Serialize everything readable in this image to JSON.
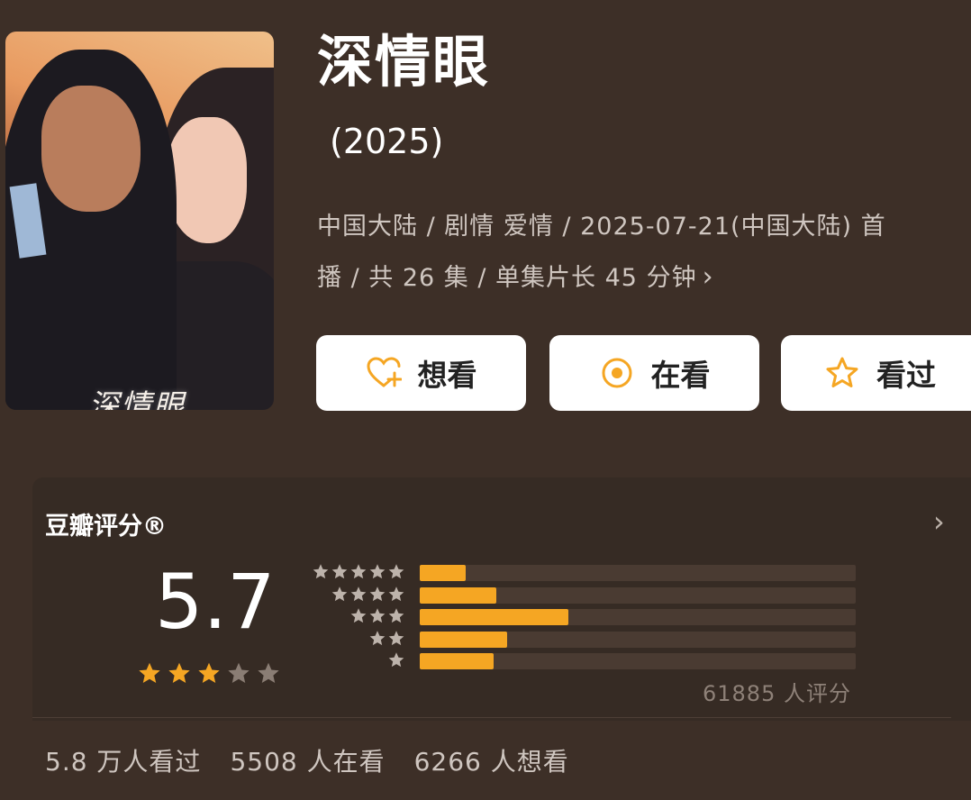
{
  "poster": {
    "title_art": "深情眼"
  },
  "title": "深情眼",
  "year": "(2025)",
  "meta": {
    "line1": "中国大陆 / 剧情 爱情 / 2025-07-21(中国大陆) 首",
    "line2": "播 / 共 26 集 / 单集片长 45 分钟"
  },
  "actions": {
    "want": "想看",
    "watching": "在看",
    "watched": "看过"
  },
  "rating": {
    "label": "豆瓣评分®",
    "score": "5.7",
    "score_stars": 3,
    "distribution": [
      {
        "stars": 5,
        "fraction": 0.105
      },
      {
        "stars": 4,
        "fraction": 0.175
      },
      {
        "stars": 3,
        "fraction": 0.34
      },
      {
        "stars": 2,
        "fraction": 0.2
      },
      {
        "stars": 1,
        "fraction": 0.17
      }
    ],
    "total": "61885 人评分"
  },
  "stats": {
    "watched": "5.8 万人看过",
    "watching": "5508 人在看",
    "want": "6266 人想看"
  },
  "colors": {
    "background": "#3d2f27",
    "accent": "#f5a623",
    "star_empty": "#8a7d74"
  }
}
